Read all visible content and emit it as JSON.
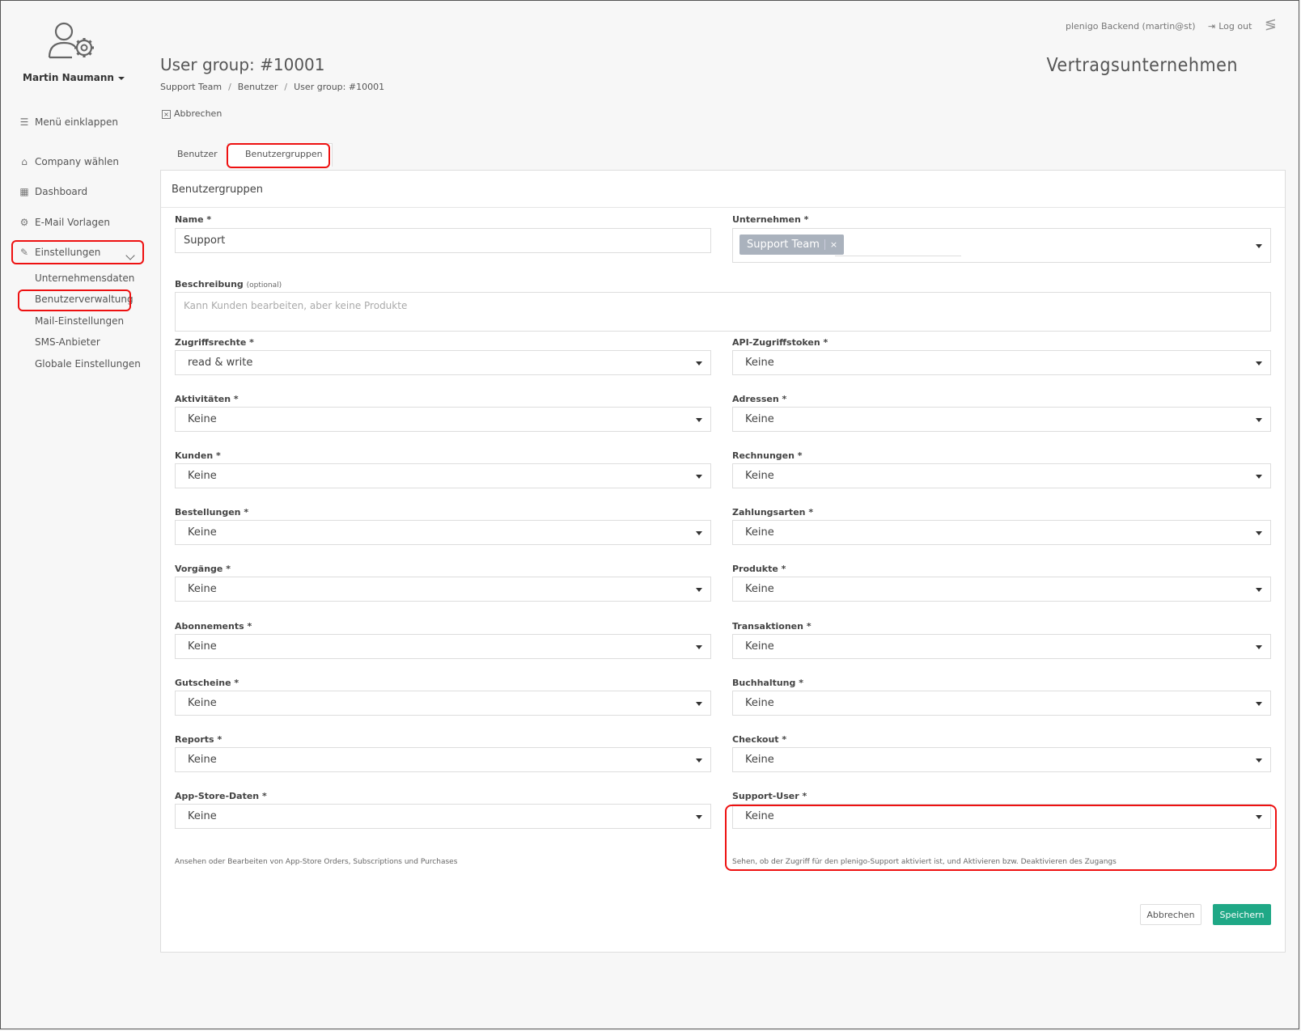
{
  "sidebar": {
    "user_name": "Martin Naumann",
    "collapse_label": "Menü einklappen",
    "items": [
      {
        "label": "Company wählen",
        "icon": "home-icon"
      },
      {
        "label": "Dashboard",
        "icon": "grid-icon"
      },
      {
        "label": "E-Mail Vorlagen",
        "icon": "mail-settings-icon"
      },
      {
        "label": "Einstellungen",
        "icon": "wrench-icon"
      }
    ],
    "sub_items": [
      "Unternehmensdaten",
      "Benutzerverwaltung",
      "Mail-Einstellungen",
      "SMS-Anbieter",
      "Globale Einstellungen"
    ]
  },
  "topbar": {
    "account": "plenigo Backend (martin@st)",
    "logout": "Log out"
  },
  "brand_title": "Vertragsunternehmen",
  "page_title": "User group: #10001",
  "breadcrumb": [
    "Support Team",
    "Benutzer",
    "User group: #10001"
  ],
  "cancel_link": "Abbrechen",
  "tabs": [
    "Benutzer",
    "Benutzergruppen"
  ],
  "panel_title": "Benutzergruppen",
  "form": {
    "name_label": "Name",
    "name_value": "Support",
    "company_label": "Unternehmen",
    "company_tag": "Support Team",
    "company_tag_remove": "×",
    "description_label": "Beschreibung",
    "description_optional": "(optional)",
    "description_placeholder": "Kann Kunden bearbeiten, aber keine Produkte",
    "required_mark": "*",
    "fields": [
      {
        "label": "Zugriffsrechte",
        "value": "read & write"
      },
      {
        "label": "API-Zugriffstoken",
        "value": "Keine"
      },
      {
        "label": "Aktivitäten",
        "value": "Keine"
      },
      {
        "label": "Adressen",
        "value": "Keine"
      },
      {
        "label": "Kunden",
        "value": "Keine"
      },
      {
        "label": "Rechnungen",
        "value": "Keine"
      },
      {
        "label": "Bestellungen",
        "value": "Keine"
      },
      {
        "label": "Zahlungsarten",
        "value": "Keine"
      },
      {
        "label": "Vorgänge",
        "value": "Keine"
      },
      {
        "label": "Produkte",
        "value": "Keine"
      },
      {
        "label": "Abonnements",
        "value": "Keine"
      },
      {
        "label": "Transaktionen",
        "value": "Keine"
      },
      {
        "label": "Gutscheine",
        "value": "Keine"
      },
      {
        "label": "Buchhaltung",
        "value": "Keine"
      },
      {
        "label": "Reports",
        "value": "Keine"
      },
      {
        "label": "Checkout",
        "value": "Keine"
      },
      {
        "label": "App-Store-Daten",
        "value": "Keine"
      },
      {
        "label": "Support-User",
        "value": "Keine"
      }
    ],
    "help_appstore": "Ansehen oder Bearbeiten von App-Store Orders, Subscriptions und Purchases",
    "help_support": "Sehen, ob der Zugriff für den plenigo-Support aktiviert ist, und Aktivieren bzw. Deaktivieren des Zugangs",
    "cancel_button": "Abbrechen",
    "save_button": "Speichern"
  },
  "colors": {
    "primary": "#1fa886",
    "highlight": "#e11111",
    "tag": "#aab2bd"
  }
}
